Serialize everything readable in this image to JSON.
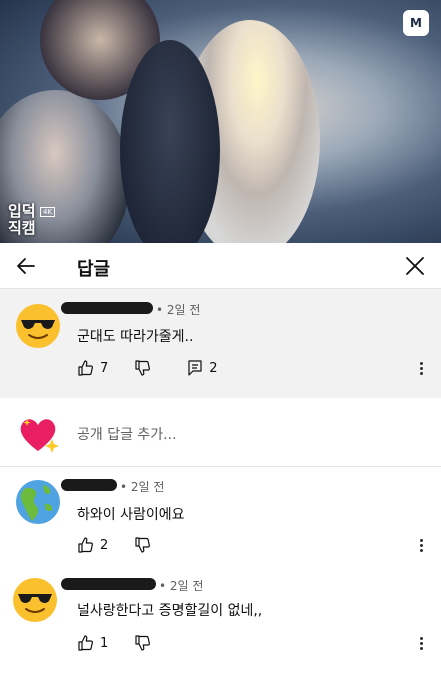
{
  "video": {
    "mnet_logo": "M",
    "brand_line1": "입덕",
    "brand_line2": "직캠",
    "live_tag": "4K"
  },
  "header": {
    "title": "답글",
    "back_icon": "arrow-left-icon",
    "close_icon": "close-icon"
  },
  "parent_comment": {
    "avatar_icon": "sunglasses-emoji-icon",
    "time": "• 2일 전",
    "text": "군대도 따라가줄게..",
    "likes": "7",
    "replies": "2"
  },
  "add_reply": {
    "avatar_icon": "sparkling-heart-emoji-icon",
    "placeholder": "공개 답글 추가..."
  },
  "replies": [
    {
      "avatar_icon": "globe-americas-emoji-icon",
      "time": "• 2일 전",
      "text": "하와이 사람이에요",
      "likes": "2"
    },
    {
      "avatar_icon": "sunglasses-emoji-icon",
      "time": "• 2일 전",
      "text": "널사랑한다고 증명할길이 없네,,",
      "likes": "1"
    }
  ],
  "colors": {
    "parent_background": "#f2f2f2",
    "secondary_text": "#606060",
    "primary_text": "#0f0f0f"
  }
}
